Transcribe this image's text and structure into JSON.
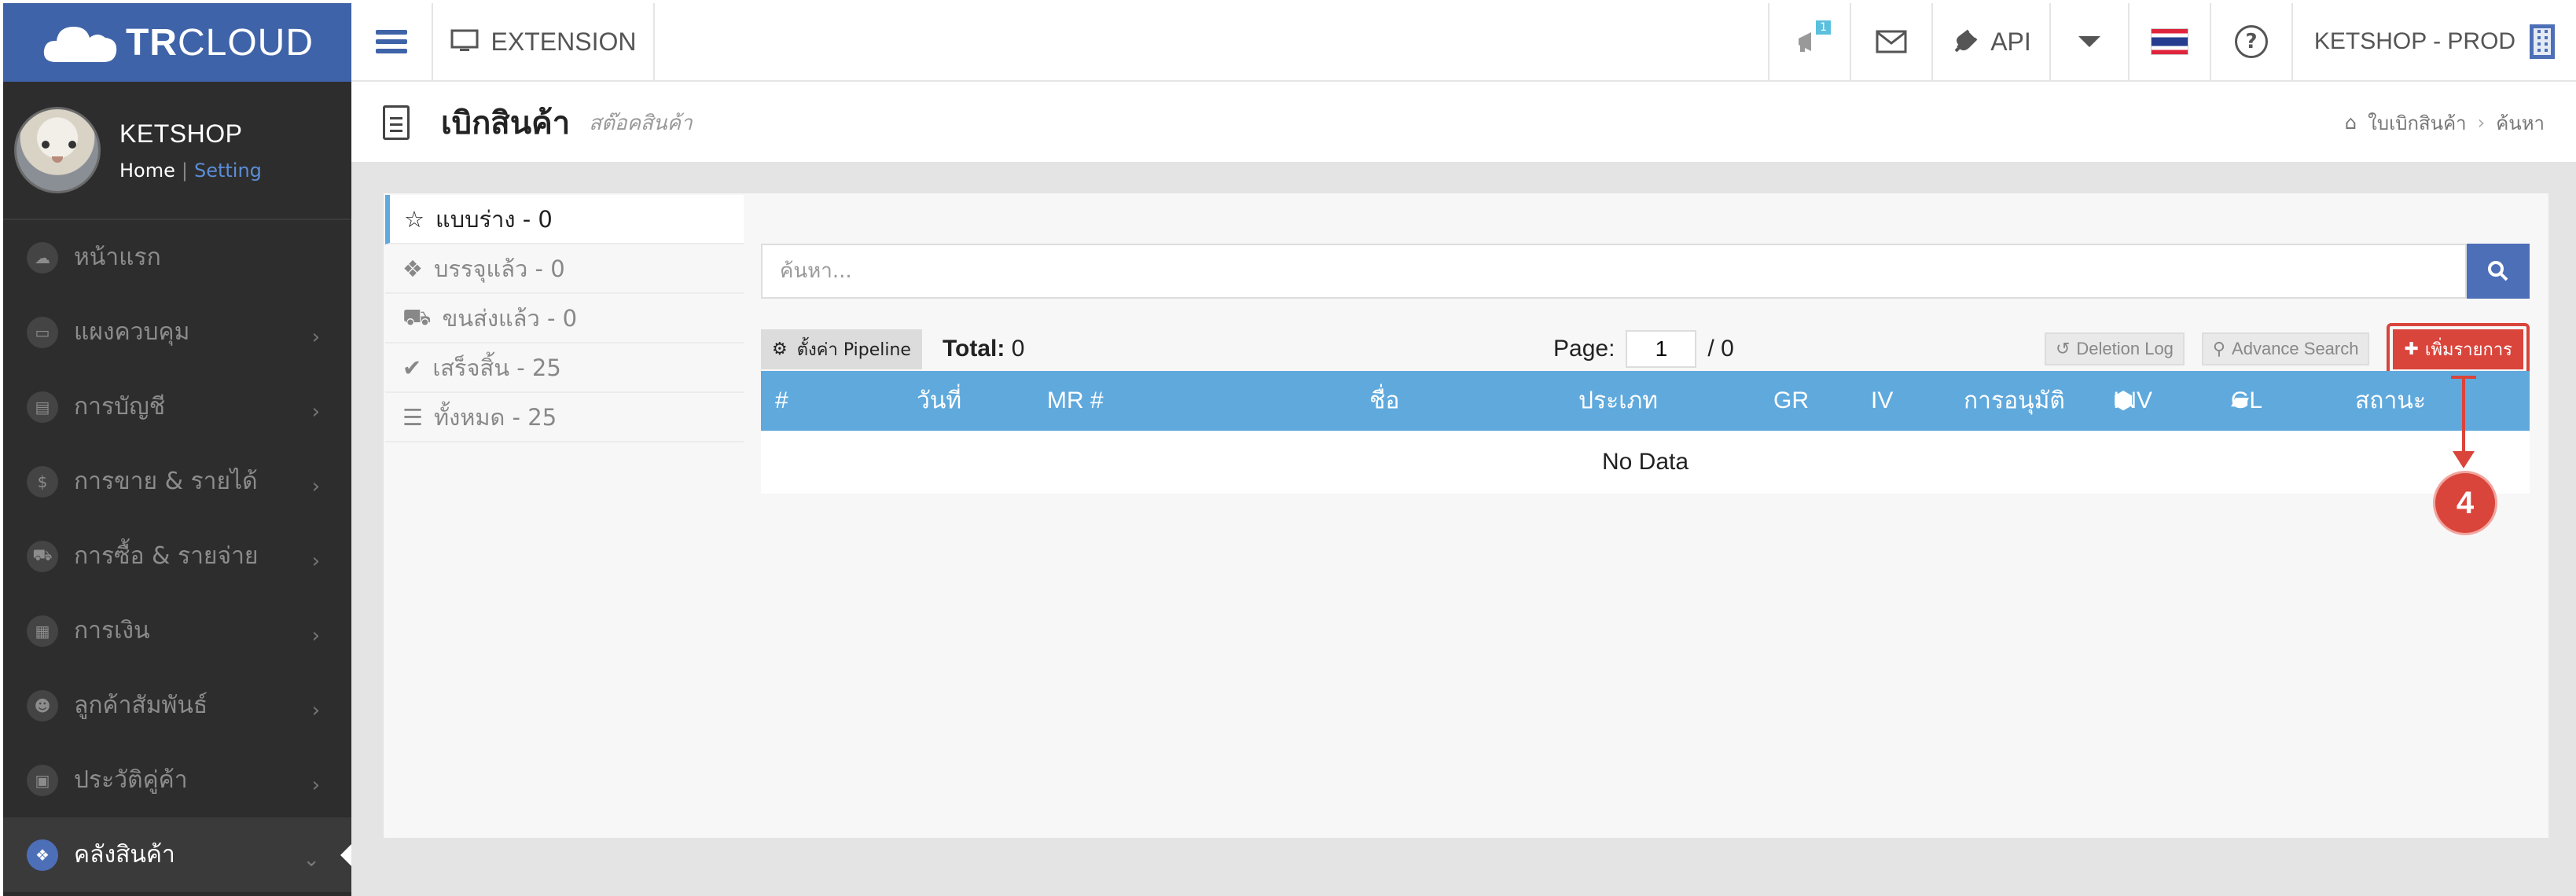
{
  "brand": {
    "bold": "TR",
    "rest": "CLOUD"
  },
  "profile": {
    "name": "KETSHOP",
    "home": "Home",
    "sep": "|",
    "setting": "Setting"
  },
  "sidebar": {
    "items": [
      {
        "label": "หน้าแรก",
        "icon": "cloud-icon"
      },
      {
        "label": "แผงควบคุม",
        "icon": "monitor-icon"
      },
      {
        "label": "การบัญชี",
        "icon": "book-icon"
      },
      {
        "label": "การขาย & รายได้",
        "icon": "dollar-icon"
      },
      {
        "label": "การซื้อ & รายจ่าย",
        "icon": "cart-icon"
      },
      {
        "label": "การเงิน",
        "icon": "calendar-icon"
      },
      {
        "label": "ลูกค้าสัมพันธ์",
        "icon": "users-icon"
      },
      {
        "label": "ประวัติคู่ค้า",
        "icon": "contact-icon"
      },
      {
        "label": "คลังสินค้า",
        "icon": "cubes-icon"
      }
    ]
  },
  "topbar": {
    "extension": "EXTENSION",
    "notify_badge": "1",
    "api": "API",
    "user": "KETSHOP - PROD"
  },
  "page": {
    "title": "เบิกสินค้า",
    "subtitle": "สต๊อคสินค้า",
    "breadcrumb": [
      "ใบเบิกสินค้า",
      "ค้นหา"
    ]
  },
  "tabs": [
    {
      "label": "แบบร่าง - 0",
      "icon": "star-icon"
    },
    {
      "label": "บรรจุแล้ว - 0",
      "icon": "dropbox-icon"
    },
    {
      "label": "ขนส่งแล้ว - 0",
      "icon": "truck-icon"
    },
    {
      "label": "เสร็จสิ้น - 25",
      "icon": "check-circle-icon"
    },
    {
      "label": "ทั้งหมด - 25",
      "icon": "list-icon"
    }
  ],
  "search": {
    "placeholder": "ค้นหา..."
  },
  "toolbar": {
    "pipeline_label": "ตั้งค่า Pipeline",
    "total_label": "Total:",
    "total_value": "0",
    "page_label": "Page:",
    "page_value": "1",
    "page_of": "/ 0",
    "deletion_log": "Deletion Log",
    "advance_search": "Advance Search",
    "add_label": "เพิ่มรายการ"
  },
  "table": {
    "columns": [
      "#",
      "วันที่",
      "MR #",
      "ชื่อ",
      "ประเภท",
      "GR",
      "IV",
      "การอนุมัติ",
      "INV",
      "GL",
      "สถานะ"
    ],
    "empty": "No Data"
  },
  "annotation": {
    "number": "4"
  },
  "colors": {
    "brand_blue": "#3f63a8",
    "sidebar_bg": "#2d2d2d",
    "table_header": "#5fa9dd",
    "add_button": "#d9443b"
  }
}
